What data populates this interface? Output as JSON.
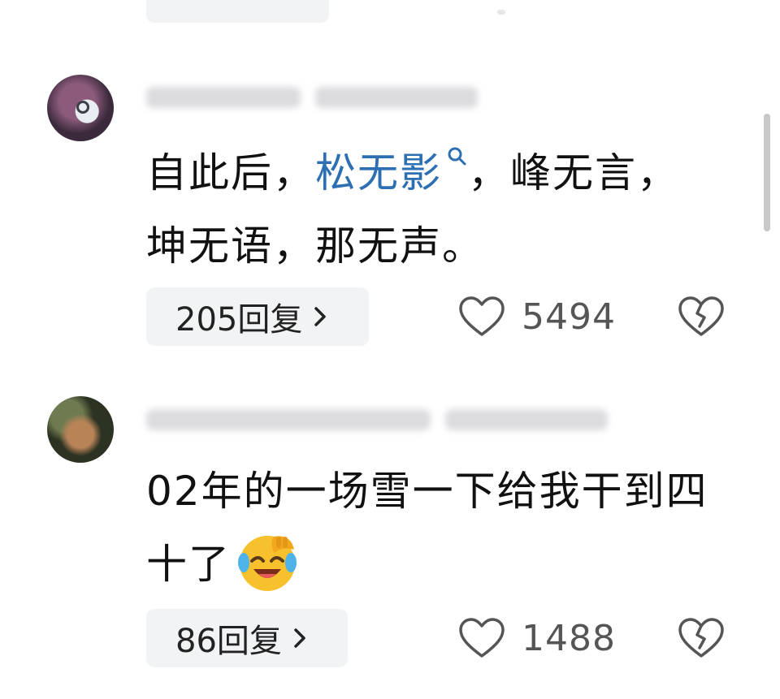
{
  "comments": [
    {
      "content_pre": "自此后，",
      "content_link": "松无影",
      "content_post": "，峰无言，坤无语，那无声。",
      "reply_label": "205回复",
      "like_count": "5494"
    },
    {
      "content_text": "02年的一场雪一下给我干到四十了",
      "reply_label": "86回复",
      "like_count": "1488"
    }
  ],
  "icons": {
    "link_search": "search-icon",
    "like": "heart-icon",
    "dislike": "broken-heart-icon",
    "chevron": "chevron-right-icon",
    "emoji": "laughing-crying-emoji"
  },
  "colors": {
    "link": "#2d6fb3",
    "reply_bg": "#f2f3f5",
    "text": "#111111",
    "muted": "#555555"
  }
}
